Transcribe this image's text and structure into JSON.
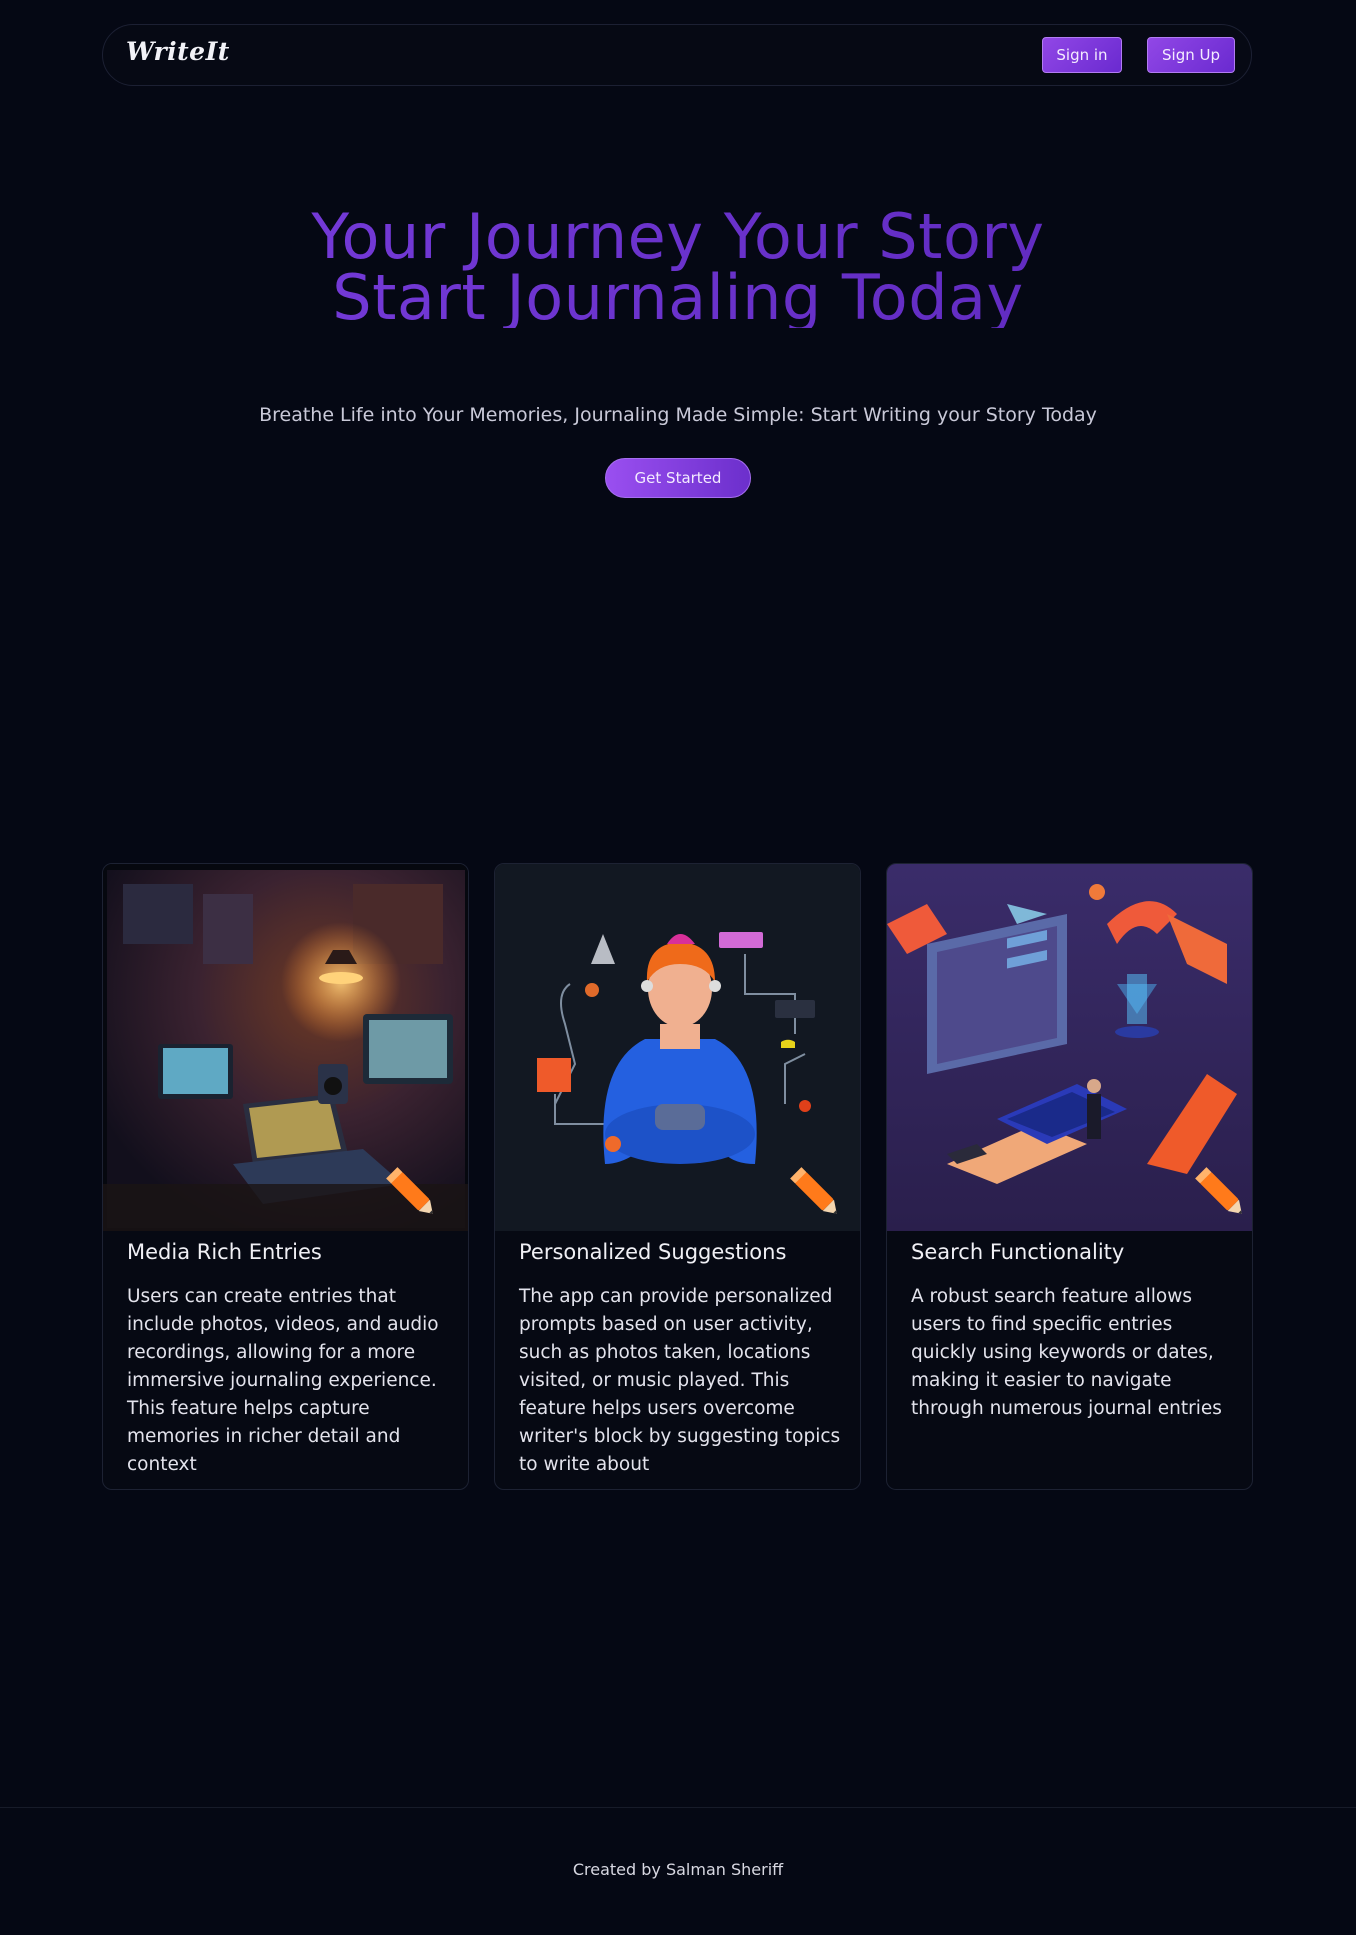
{
  "nav": {
    "logo": "WriteIt",
    "sign_in": "Sign in",
    "sign_up": "Sign Up"
  },
  "hero": {
    "title_line1": "Your Journey Your Story",
    "title_line2": "Start Journaling Today",
    "subtitle": "Breathe Life into Your Memories, Journaling Made Simple: Start Writing your Story Today",
    "cta": "Get Started"
  },
  "features": [
    {
      "title": "Media Rich Entries",
      "text": "Users can create entries that include photos, videos, and audio recordings, allowing for a more immersive journaling experience. This feature helps capture memories in richer detail and context"
    },
    {
      "title": "Personalized Suggestions",
      "text": "The app can provide personalized prompts based on user activity, such as photos taken, locations visited, or music played. This feature helps users overcome writer's block by suggesting topics to write about"
    },
    {
      "title": "Search Functionality",
      "text": "A robust search feature allows users to find specific entries quickly using keywords or dates, making it easier to navigate through numerous journal entries"
    }
  ],
  "footer": {
    "credit": "Created by Salman Sheriff"
  },
  "colors": {
    "background": "#050814",
    "accent": "#8b44e8",
    "title_gradient_start": "#7b3fe0",
    "title_gradient_end": "#5a26b8"
  },
  "icons": [
    "pencil-icon"
  ]
}
